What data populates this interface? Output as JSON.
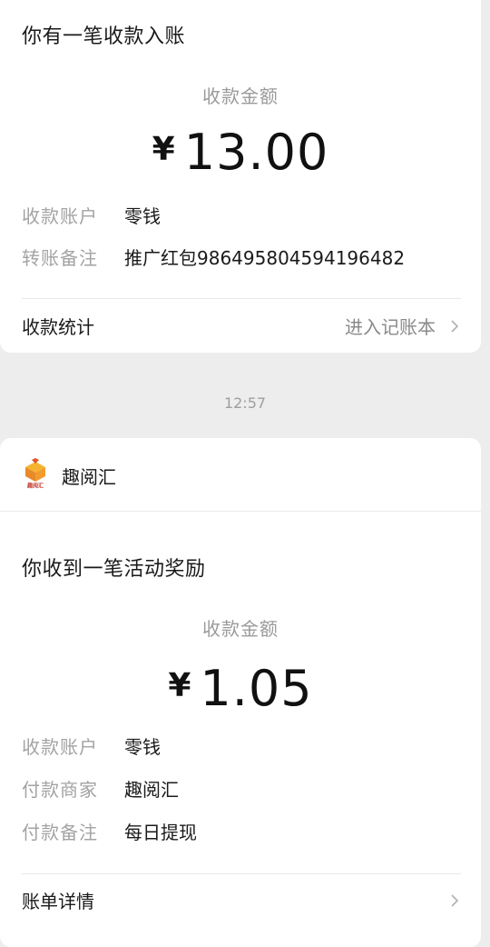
{
  "card1": {
    "title": "你有一笔收款入账",
    "amount_label": "收款金额",
    "currency": "¥",
    "amount": "13.00",
    "rows": [
      {
        "key": "收款账户",
        "value": "零钱"
      },
      {
        "key": "转账备注",
        "value": "推广红包9864958045941964​82"
      }
    ],
    "footer_label": "收款统计",
    "footer_link": "进入记账本"
  },
  "timestamp": "12:57",
  "card2": {
    "merchant_name": "趣阅汇",
    "logo_text": "趣阅汇",
    "title": "你收到一笔活动奖励",
    "amount_label": "收款金额",
    "currency": "¥",
    "amount": "1.05",
    "rows": [
      {
        "key": "收款账户",
        "value": "零钱"
      },
      {
        "key": "付款商家",
        "value": "趣阅汇"
      },
      {
        "key": "付款备注",
        "value": "每日提现"
      }
    ],
    "footer_label": "账单详情"
  }
}
